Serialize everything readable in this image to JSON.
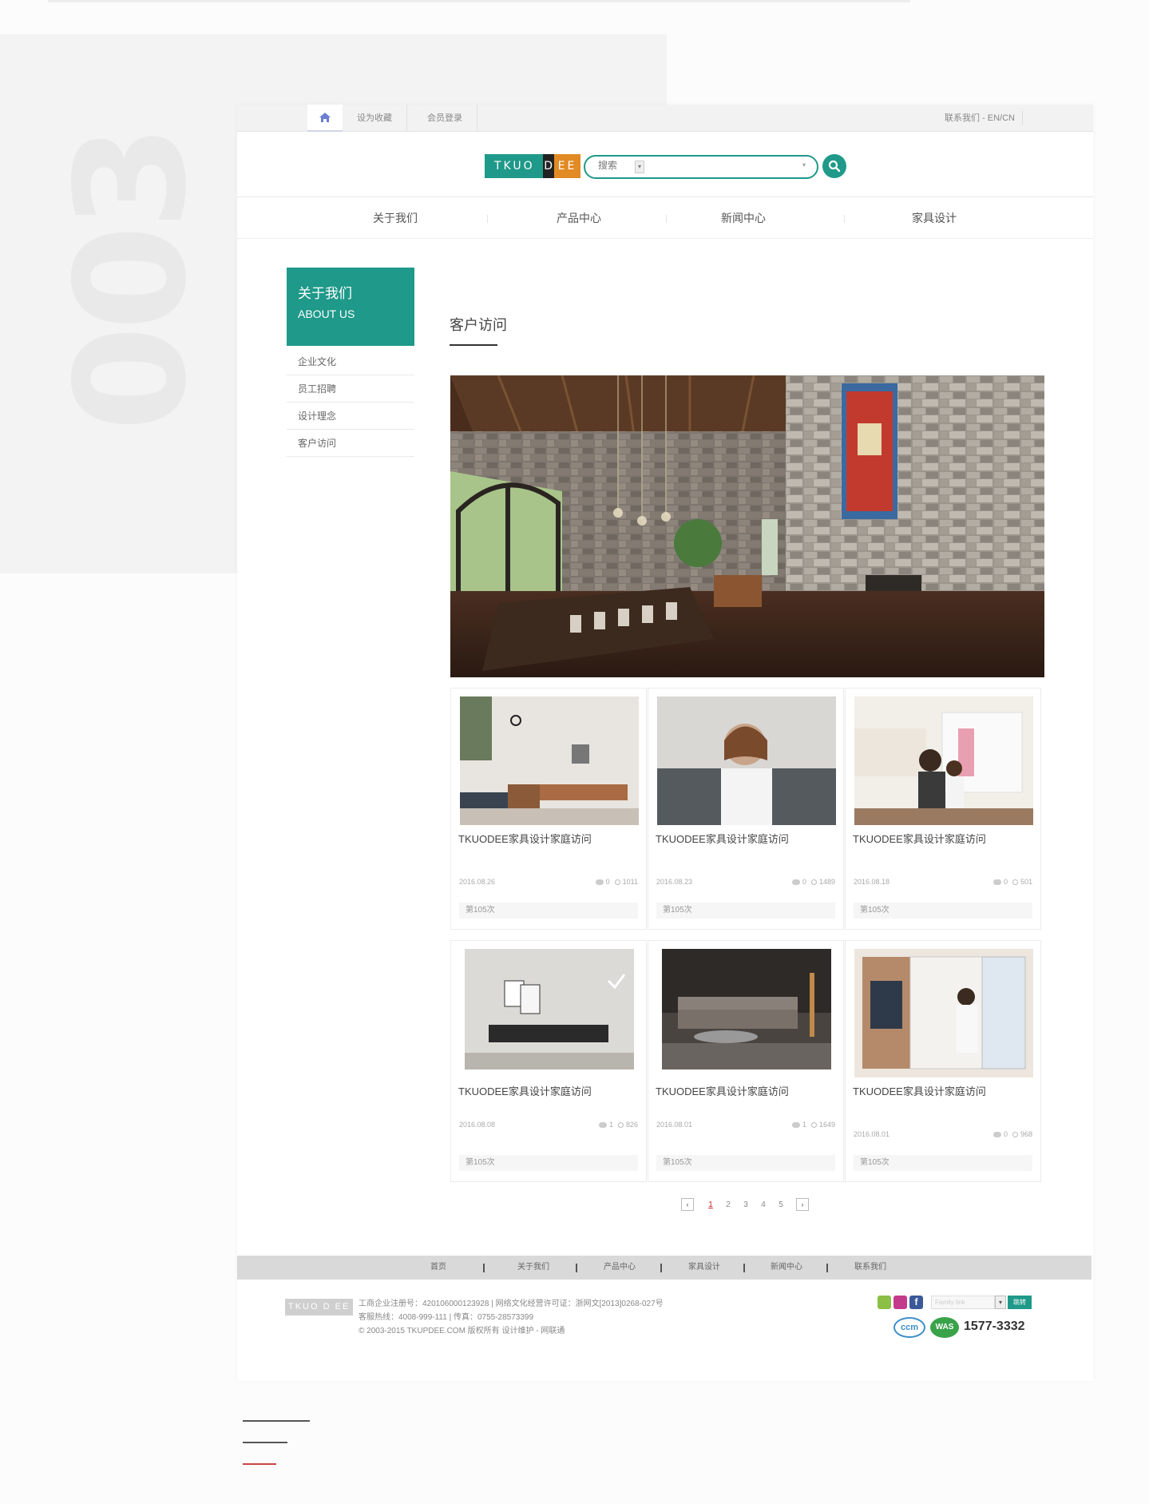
{
  "bg": {
    "digits": "003"
  },
  "topbar": {
    "bookmark": "设为收藏",
    "login": "会员登录",
    "contact": "联系我们 -",
    "lang": "EN/CN"
  },
  "header": {
    "logo_a": "TKUO",
    "logo_b": "D",
    "logo_c": "EE",
    "search_placeholder": "搜索",
    "search_select": "▾"
  },
  "nav": {
    "items": [
      {
        "label": "关于我们"
      },
      {
        "label": "产品中心"
      },
      {
        "label": "新闻中心"
      },
      {
        "label": "家具设计"
      }
    ]
  },
  "sidebar": {
    "title_cn": "关于我们",
    "title_en": "ABOUT US",
    "items": [
      {
        "label": "企业文化"
      },
      {
        "label": "员工招聘"
      },
      {
        "label": "设计理念"
      },
      {
        "label": "客户访问"
      }
    ]
  },
  "main": {
    "title": "客户访问"
  },
  "cards": [
    {
      "title": "TKUODEE家具设计家庭访问",
      "date": "2016.08.26",
      "comments": "0",
      "views": "1011",
      "foot": "第105次"
    },
    {
      "title": "TKUODEE家具设计家庭访问",
      "date": "2016.08.23",
      "comments": "0",
      "views": "1489",
      "foot": "第105次"
    },
    {
      "title": "TKUODEE家具设计家庭访问",
      "date": "2016.08.18",
      "comments": "0",
      "views": "501",
      "foot": "第105次"
    },
    {
      "title": "TKUODEE家具设计家庭访问",
      "date": "2016.08.08",
      "comments": "1",
      "views": "826",
      "foot": "第105次"
    },
    {
      "title": "TKUODEE家具设计家庭访问",
      "date": "2016.08.01",
      "comments": "1",
      "views": "1649",
      "foot": "第105次"
    },
    {
      "title": "TKUODEE家具设计家庭访问",
      "date": "2016.08.01",
      "comments": "0",
      "views": "968",
      "foot": "第105次"
    }
  ],
  "pager": {
    "prev": "‹",
    "next": "›",
    "pages": [
      "1",
      "2",
      "3",
      "4",
      "5"
    ],
    "current": "1"
  },
  "footnav": {
    "items": [
      {
        "label": "首页"
      },
      {
        "label": "关于我们"
      },
      {
        "label": "产品中心"
      },
      {
        "label": "家具设计"
      },
      {
        "label": "新闻中心"
      },
      {
        "label": "联系我们"
      }
    ]
  },
  "footer": {
    "logo": "TKUO D EE",
    "line1": "工商企业注册号：420106000123928 | 网络文化经营许可证：浙网文[2013]0268-027号",
    "line2": "客服热线：4008-999-111 | 传真：0755-28573399",
    "line3": "© 2003-2015 TKUPDEE.COM 版权所有 设计维护 - 网联通",
    "family_placeholder": "Family link",
    "go": "跳转",
    "ccm": "ccm",
    "was": "WAS",
    "phone": "1577-3332"
  },
  "colors": {
    "accent": "#1f9989",
    "orange": "#e28a24",
    "pager_current": "#cc2222"
  }
}
